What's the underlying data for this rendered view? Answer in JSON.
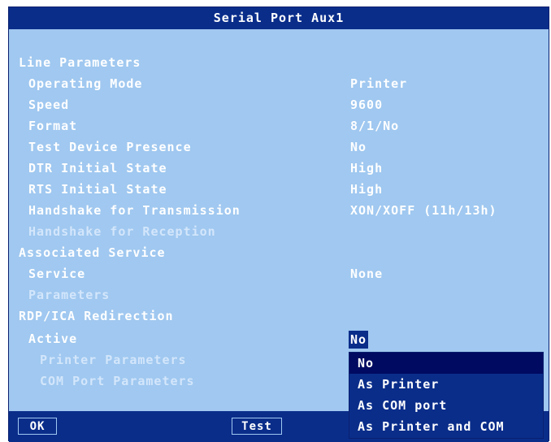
{
  "window": {
    "title": "Serial Port Aux1"
  },
  "rows": [
    {
      "label": "Line Parameters",
      "value": ""
    },
    {
      "label": "Operating Mode",
      "value": "Printer"
    },
    {
      "label": "Speed",
      "value": "9600"
    },
    {
      "label": "Format",
      "value": "8/1/No"
    },
    {
      "label": "Test Device Presence",
      "value": "No"
    },
    {
      "label": "DTR Initial State",
      "value": "High"
    },
    {
      "label": "RTS Initial State",
      "value": "High"
    },
    {
      "label": "Handshake for Transmission",
      "value": "XON/XOFF (11h/13h)"
    },
    {
      "label": "Handshake for Reception",
      "value": ""
    },
    {
      "label": "Associated Service",
      "value": ""
    },
    {
      "label": "Service",
      "value": "None"
    },
    {
      "label": "Parameters",
      "value": ""
    },
    {
      "label": "RDP/ICA Redirection",
      "value": ""
    },
    {
      "label": "Active",
      "value": "No"
    },
    {
      "label": "Printer Parameters",
      "value": ""
    },
    {
      "label": "COM Port Parameters",
      "value": ""
    }
  ],
  "dropdown": {
    "options": [
      "No",
      "As Printer",
      "As COM port",
      "As Printer and COM"
    ]
  },
  "buttons": {
    "ok": "OK",
    "test": "Test"
  }
}
